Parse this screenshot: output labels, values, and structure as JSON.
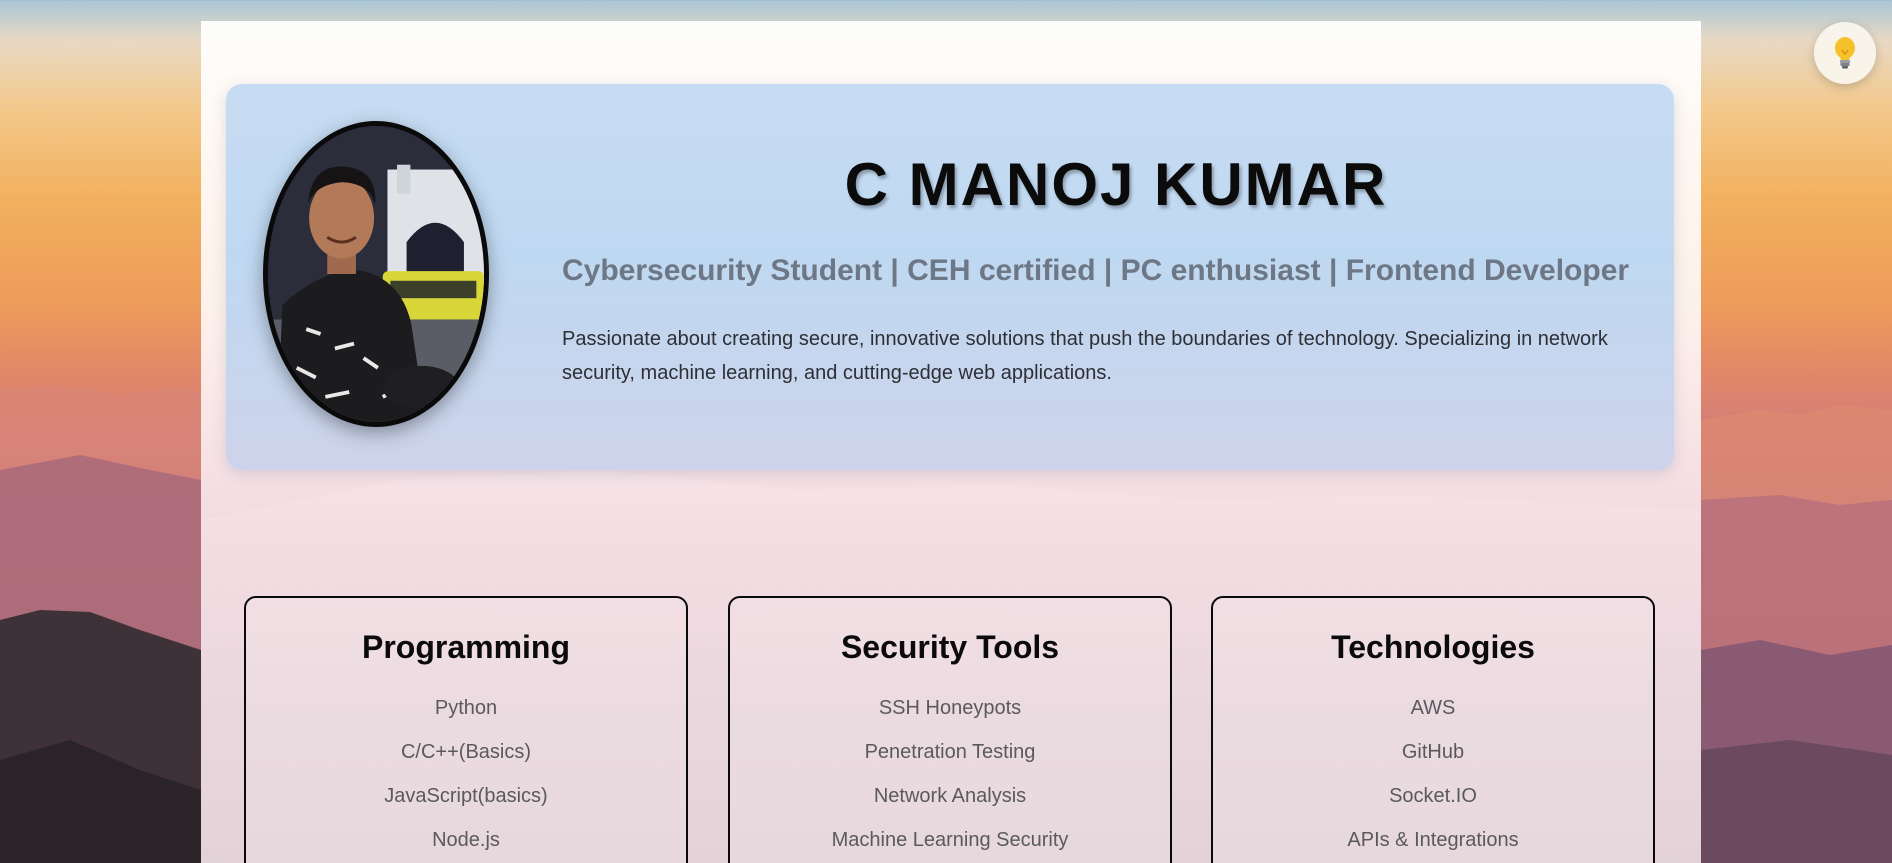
{
  "profile": {
    "name": "C MANOJ KUMAR",
    "tagline": "Cybersecurity Student | CEH certified | PC enthusiast | Frontend Developer",
    "bio": "Passionate about creating secure, innovative solutions that push the boundaries of technology. Specializing in network security, machine learning, and cutting-edge web applications."
  },
  "theme_toggle": {
    "icon": "lightbulb-icon"
  },
  "skills": [
    {
      "title": "Programming",
      "items": [
        "Python",
        "C/C++(Basics)",
        "JavaScript(basics)",
        "Node.js"
      ]
    },
    {
      "title": "Security Tools",
      "items": [
        "SSH Honeypots",
        "Penetration Testing",
        "Network Analysis",
        "Machine Learning Security"
      ]
    },
    {
      "title": "Technologies",
      "items": [
        "AWS",
        "GitHub",
        "Socket.IO",
        "APIs & Integrations"
      ]
    }
  ],
  "colors": {
    "hero_background": "#c6dcf2",
    "tagline": "#6e7786",
    "card_border": "#0a0a0a"
  }
}
